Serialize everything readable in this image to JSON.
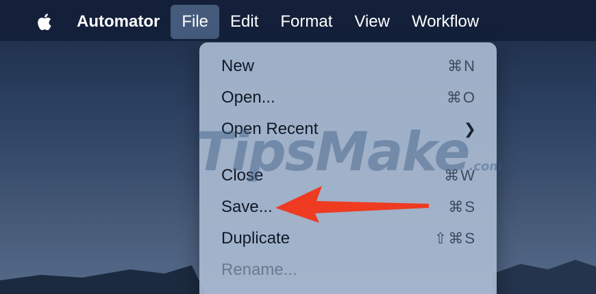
{
  "menubar": {
    "apple_icon": "apple-logo-icon",
    "app_name": "Automator",
    "items": [
      "File",
      "Edit",
      "Format",
      "View",
      "Workflow"
    ],
    "active": "File"
  },
  "file_menu": {
    "items": [
      {
        "label": "New",
        "shortcut": "⌘N"
      },
      {
        "label": "Open...",
        "shortcut": "⌘O"
      },
      {
        "label": "Open Recent",
        "submenu_icon": "chevron-right-icon"
      },
      {
        "label": "Close",
        "shortcut": "⌘W"
      },
      {
        "label": "Save...",
        "shortcut": "⌘S"
      },
      {
        "label": "Duplicate",
        "shortcut": "⇧⌘S"
      },
      {
        "label": "Rename...",
        "disabled": true
      }
    ]
  },
  "watermark": {
    "text": "TipsMake",
    "suffix": ".com"
  },
  "colors": {
    "arrow": "#ee3b22",
    "menu_bg": "#a8b9d0",
    "menubar_bg": "#142038"
  }
}
